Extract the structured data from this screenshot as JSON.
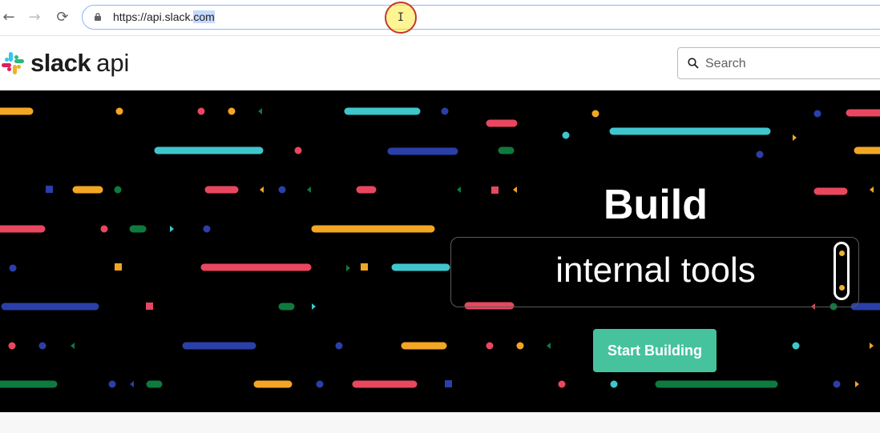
{
  "browser": {
    "url_main": "https://api.slack.",
    "url_selected": "com",
    "icons": {
      "back": "arrow-left-icon",
      "forward": "arrow-right-icon",
      "reload": "reload-icon",
      "lock": "lock-icon"
    }
  },
  "header": {
    "logo_word": "slack",
    "logo_suffix": "api",
    "search_placeholder": "Search"
  },
  "hero": {
    "title": "Build",
    "rotating_text": "internal tools",
    "cta_label": "Start Building",
    "colors": {
      "background": "#000000",
      "cta": "#46c39c",
      "red": "#e8475f",
      "cyan": "#3fc6cd",
      "blue": "#2a3fa8",
      "yellow": "#f2a623",
      "green": "#0e7a3e"
    }
  }
}
